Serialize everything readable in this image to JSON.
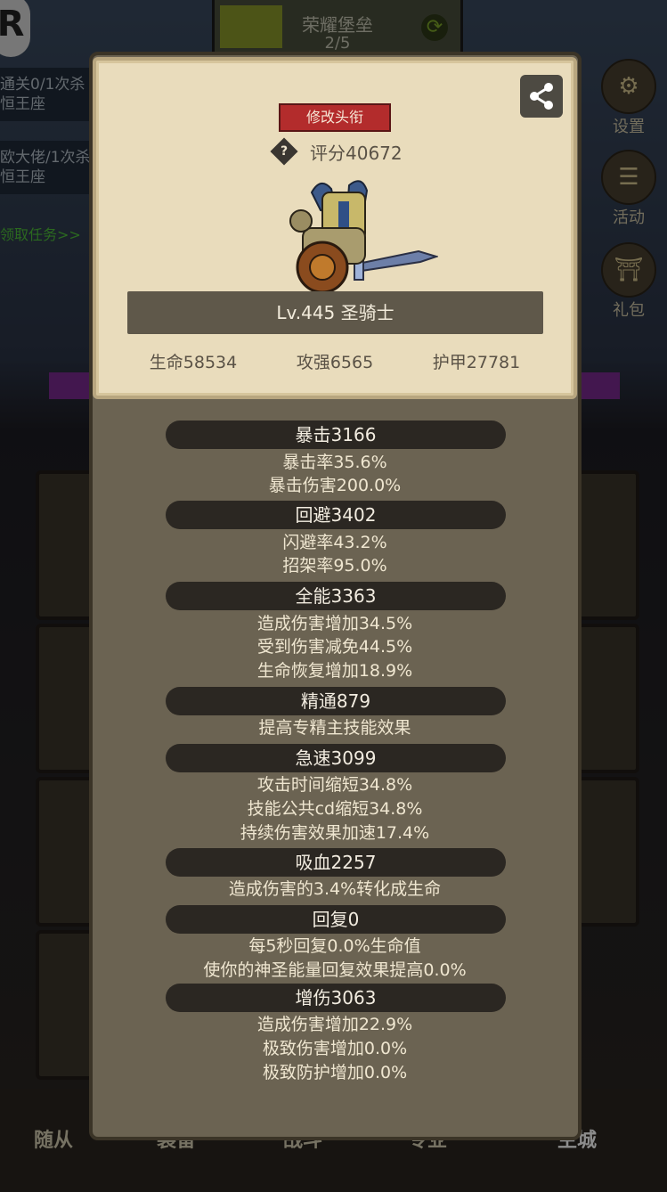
{
  "background": {
    "top_title": "荣耀堡垒",
    "top_progress": "2/5",
    "quests": [
      {
        "line1": "通关0/1次杀",
        "line2": "恒王座"
      },
      {
        "line1": "欧大佬/1次杀",
        "line2": "恒王座"
      }
    ],
    "quest_link": "领取任务>>",
    "side_buttons": [
      "设置",
      "活动",
      "礼包"
    ],
    "bottom_tabs": [
      "随从",
      "装备",
      "战斗",
      "专业",
      "主城"
    ]
  },
  "card": {
    "title_button": "修改头衔",
    "score": "评分40672",
    "level_class": "Lv.445 圣骑士",
    "stats": [
      "生命58534",
      "攻强6565",
      "护甲27781"
    ]
  },
  "attributes": [
    {
      "header": "暴击3166",
      "lines": [
        "暴击率35.6%",
        "暴击伤害200.0%"
      ]
    },
    {
      "header": "回避3402",
      "lines": [
        "闪避率43.2%",
        "招架率95.0%"
      ]
    },
    {
      "header": "全能3363",
      "lines": [
        "造成伤害增加34.5%",
        "受到伤害减免44.5%",
        "生命恢复增加18.9%"
      ]
    },
    {
      "header": "精通879",
      "lines": [
        "提高专精主技能效果"
      ]
    },
    {
      "header": "急速3099",
      "lines": [
        "攻击时间缩短34.8%",
        "技能公共cd缩短34.8%",
        "持续伤害效果加速17.4%"
      ]
    },
    {
      "header": "吸血2257",
      "lines": [
        "造成伤害的3.4%转化成生命"
      ]
    },
    {
      "header": "回复0",
      "lines": [
        "每5秒回复0.0%生命值",
        "使你的神圣能量回复效果提高0.0%"
      ]
    },
    {
      "header": "增伤3063",
      "lines": [
        "造成伤害增加22.9%",
        "极致伤害增加0.0%",
        "极致防护增加0.0%"
      ]
    }
  ],
  "icons": {
    "share": "share-icon",
    "help": "help-icon",
    "hero": "paladin-hero-sprite"
  }
}
